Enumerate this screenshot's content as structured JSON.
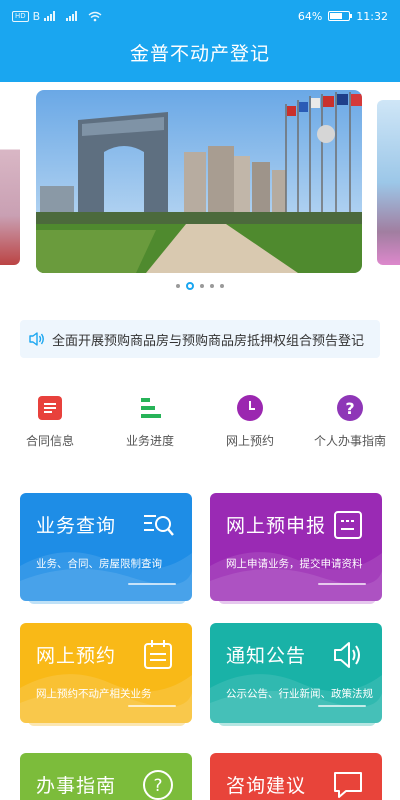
{
  "status": {
    "network_chip": "HD",
    "network_b": "B",
    "battery_percent": "64%",
    "battery_level": 0.64,
    "time": "11:32"
  },
  "header": {
    "title": "金普不动产登记"
  },
  "banner": {
    "slide_count": 5,
    "active_index": 1
  },
  "notice": {
    "text": "全面开展预购商品房与预购商品房抵押权组合预告登记"
  },
  "quick_nav": [
    {
      "label": "合同信息",
      "icon": "contract-icon",
      "color": "#e8413c"
    },
    {
      "label": "业务进度",
      "icon": "progress-icon",
      "color": "#27b358"
    },
    {
      "label": "网上预约",
      "icon": "clock-icon",
      "color": "#9b27b0"
    },
    {
      "label": "个人办事指南",
      "icon": "help-icon",
      "color": "#8e36b7"
    }
  ],
  "cards": [
    {
      "title": "业务查询",
      "desc": "业务、合同、房屋限制查询",
      "icon": "search-list-icon",
      "color": "#1e8de6"
    },
    {
      "title": "网上预申报",
      "desc": "网上申请业务，提交申请资料",
      "icon": "form-icon",
      "color": "#9a2ab4"
    },
    {
      "title": "网上预约",
      "desc": "网上预约不动产相关业务",
      "icon": "calendar-icon",
      "color": "#f9b917"
    },
    {
      "title": "通知公告",
      "desc": "公示公告、行业新闻、政策法规",
      "icon": "speaker-icon",
      "color": "#19b2a7"
    },
    {
      "title": "办事指南",
      "desc": "",
      "icon": "question-icon",
      "color": "#7cbc3b"
    },
    {
      "title": "咨询建议",
      "desc": "",
      "icon": "chat-icon",
      "color": "#e8443a"
    }
  ]
}
